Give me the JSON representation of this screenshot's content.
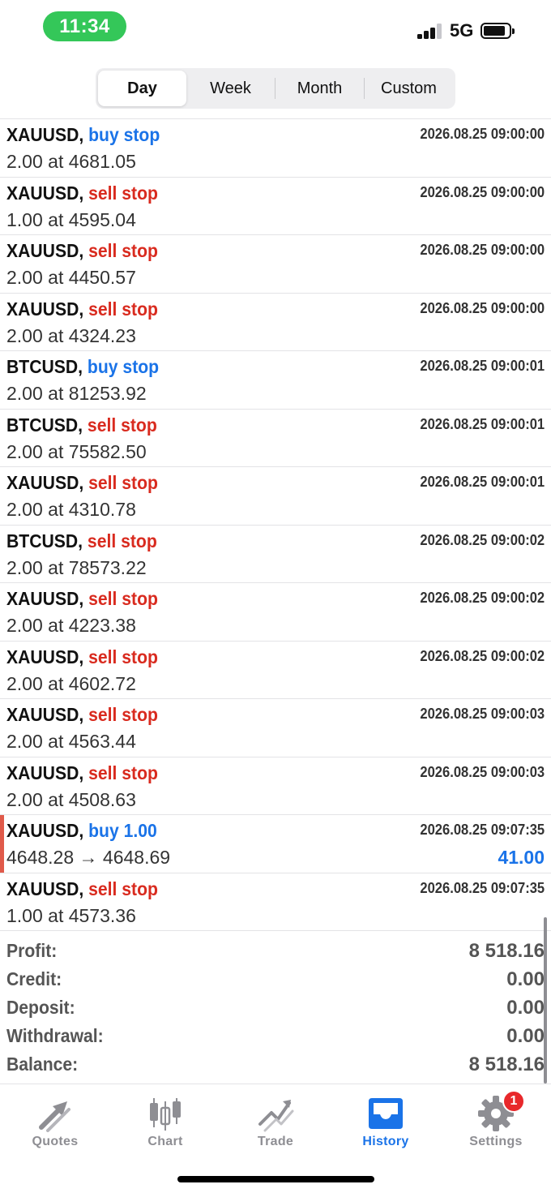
{
  "status_bar": {
    "time": "11:34",
    "network": "5G"
  },
  "period_tabs": [
    {
      "label": "Day",
      "active": true
    },
    {
      "label": "Week",
      "active": false
    },
    {
      "label": "Month",
      "active": false
    },
    {
      "label": "Custom",
      "active": false
    }
  ],
  "orders": [
    {
      "symbol": "XAUUSD",
      "direction": "buy stop",
      "side": "buy",
      "time": "2026.08.25 09:00:00",
      "detail": "2.00 at 4681.05"
    },
    {
      "symbol": "XAUUSD",
      "direction": "sell stop",
      "side": "sell",
      "time": "2026.08.25 09:00:00",
      "detail": "1.00 at 4595.04"
    },
    {
      "symbol": "XAUUSD",
      "direction": "sell stop",
      "side": "sell",
      "time": "2026.08.25 09:00:00",
      "detail": "2.00 at 4450.57"
    },
    {
      "symbol": "XAUUSD",
      "direction": "sell stop",
      "side": "sell",
      "time": "2026.08.25 09:00:00",
      "detail": "2.00 at 4324.23"
    },
    {
      "symbol": "BTCUSD",
      "direction": "buy stop",
      "side": "buy",
      "time": "2026.08.25 09:00:01",
      "detail": "2.00 at 81253.92"
    },
    {
      "symbol": "BTCUSD",
      "direction": "sell stop",
      "side": "sell",
      "time": "2026.08.25 09:00:01",
      "detail": "2.00 at 75582.50"
    },
    {
      "symbol": "XAUUSD",
      "direction": "sell stop",
      "side": "sell",
      "time": "2026.08.25 09:00:01",
      "detail": "2.00 at 4310.78"
    },
    {
      "symbol": "BTCUSD",
      "direction": "sell stop",
      "side": "sell",
      "time": "2026.08.25 09:00:02",
      "detail": "2.00 at 78573.22"
    },
    {
      "symbol": "XAUUSD",
      "direction": "sell stop",
      "side": "sell",
      "time": "2026.08.25 09:00:02",
      "detail": "2.00 at 4223.38"
    },
    {
      "symbol": "XAUUSD",
      "direction": "sell stop",
      "side": "sell",
      "time": "2026.08.25 09:00:02",
      "detail": "2.00 at 4602.72"
    },
    {
      "symbol": "XAUUSD",
      "direction": "sell stop",
      "side": "sell",
      "time": "2026.08.25 09:00:03",
      "detail": "2.00 at 4563.44"
    },
    {
      "symbol": "XAUUSD",
      "direction": "sell stop",
      "side": "sell",
      "time": "2026.08.25 09:00:03",
      "detail": "2.00 at 4508.63"
    },
    {
      "symbol": "XAUUSD",
      "direction": "buy 1.00",
      "side": "buy",
      "time": "2026.08.25 09:07:35",
      "detail": "4648.28 → 4648.69",
      "profit": "41.00",
      "marked": true
    },
    {
      "symbol": "XAUUSD",
      "direction": "sell stop",
      "side": "sell",
      "time": "2026.08.25 09:07:35",
      "detail": "1.00 at 4573.36"
    }
  ],
  "summary": {
    "profit_label": "Profit:",
    "profit_value": "8 518.16",
    "credit_label": "Credit:",
    "credit_value": "0.00",
    "deposit_label": "Deposit:",
    "deposit_value": "0.00",
    "withdrawal_label": "Withdrawal:",
    "withdrawal_value": "0.00",
    "balance_label": "Balance:",
    "balance_value": "8 518.16"
  },
  "tabbar": [
    {
      "label": "Quotes",
      "icon": "quotes-icon",
      "active": false
    },
    {
      "label": "Chart",
      "icon": "chart-icon",
      "active": false
    },
    {
      "label": "Trade",
      "icon": "trade-icon",
      "active": false
    },
    {
      "label": "History",
      "icon": "history-icon",
      "active": true
    },
    {
      "label": "Settings",
      "icon": "settings-icon",
      "active": false,
      "badge": "1"
    }
  ],
  "colors": {
    "buy": "#1a73e8",
    "sell": "#d92b1f",
    "accent": "#1a73e8",
    "inactive": "#8e8e93"
  }
}
